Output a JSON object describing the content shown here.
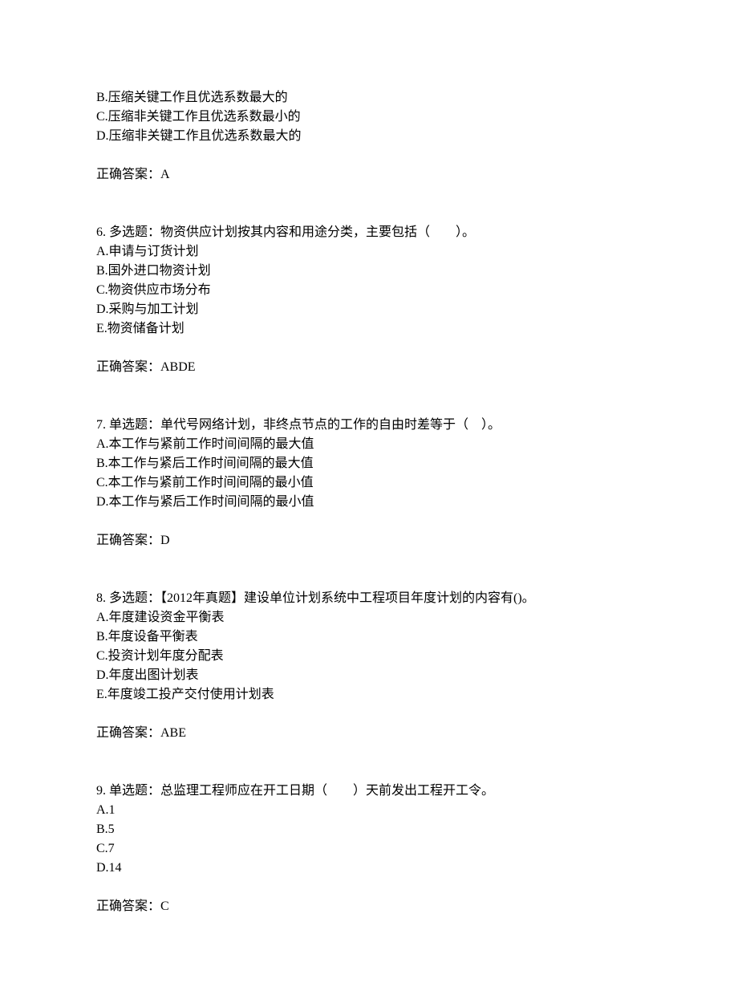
{
  "partial": {
    "options": [
      "B.压缩关键工作且优选系数最大的",
      "C.压缩非关键工作且优选系数最小的",
      "D.压缩非关键工作且优选系数最大的"
    ],
    "answer": "正确答案：A"
  },
  "questions": [
    {
      "stem": "6. 多选题：物资供应计划按其内容和用途分类，主要包括（　　）。",
      "options": [
        "A.申请与订货计划",
        "B.国外进口物资计划",
        "C.物资供应市场分布",
        "D.采购与加工计划",
        "E.物资储备计划"
      ],
      "answer": "正确答案：ABDE"
    },
    {
      "stem": "7. 单选题：单代号网络计划，非终点节点的工作的自由时差等于（　）。",
      "options": [
        "A.本工作与紧前工作时间间隔的最大值",
        "B.本工作与紧后工作时间间隔的最大值",
        "C.本工作与紧前工作时间间隔的最小值",
        "D.本工作与紧后工作时间间隔的最小值"
      ],
      "answer": "正确答案：D"
    },
    {
      "stem": "8. 多选题：【2012年真题】建设单位计划系统中工程项目年度计划的内容有()。",
      "options": [
        "A.年度建设资金平衡表",
        "B.年度设备平衡表",
        "C.投资计划年度分配表",
        "D.年度出图计划表",
        "E.年度竣工投产交付使用计划表"
      ],
      "answer": "正确答案：ABE"
    },
    {
      "stem": "9. 单选题：总监理工程师应在开工日期（　　）天前发出工程开工令。",
      "options": [
        "A.1",
        "B.5",
        "C.7",
        "D.14"
      ],
      "answer": "正确答案：C"
    }
  ]
}
